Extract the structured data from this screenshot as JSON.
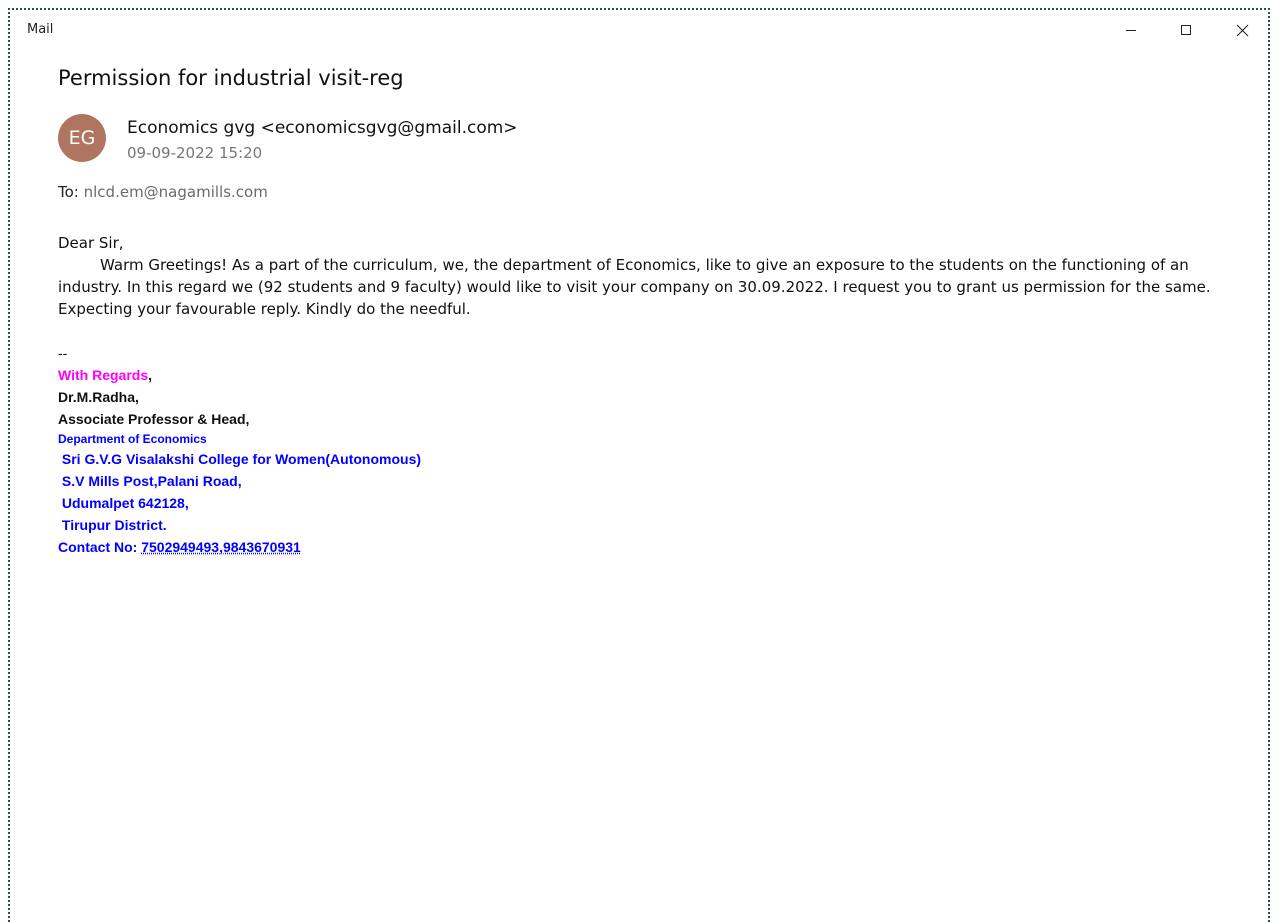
{
  "window": {
    "title": "Mail",
    "controls": [
      "minimize-icon",
      "maximize-icon",
      "close-icon"
    ]
  },
  "email": {
    "subject": "Permission for industrial visit-reg",
    "avatar_initials": "EG",
    "avatar_color": "#b07560",
    "sender": "Economics gvg <economicsgvg@gmail.com>",
    "date": "09-09-2022 15:20",
    "to_label": "To: ",
    "to_address": "nlcd.em@nagamills.com",
    "greeting": "Dear Sir,",
    "body_line1": "Warm Greetings! As a part of the curriculum, we, the department of Economics, like to give an exposure to the students on the functioning of an",
    "body_line2": "industry. In this regard we (92 students and 9 faculty) would like to visit your company on 30.09.2022. I request you to grant us permission for the same.",
    "body_line3": "Expecting your favourable reply. Kindly do the needful."
  },
  "signature": {
    "separator": "--",
    "regards": "With Regards",
    "regards_comma": ",",
    "name": "Dr.M.Radha,",
    "position": "Associate Professor & Head,",
    "department": "Department of Economics",
    "college": " Sri G.V.G Visalakshi College for Women(Autonomous)",
    "address1": " S.V Mills Post,Palani Road,",
    "address2": " Udumalpet 642128,",
    "district": " Tirupur District.",
    "contact_label": "Contact No: ",
    "contact_numbers": "7502949493,9843670931",
    "colors": {
      "regards": "#ff00ff",
      "blue": "#0000ff"
    }
  }
}
